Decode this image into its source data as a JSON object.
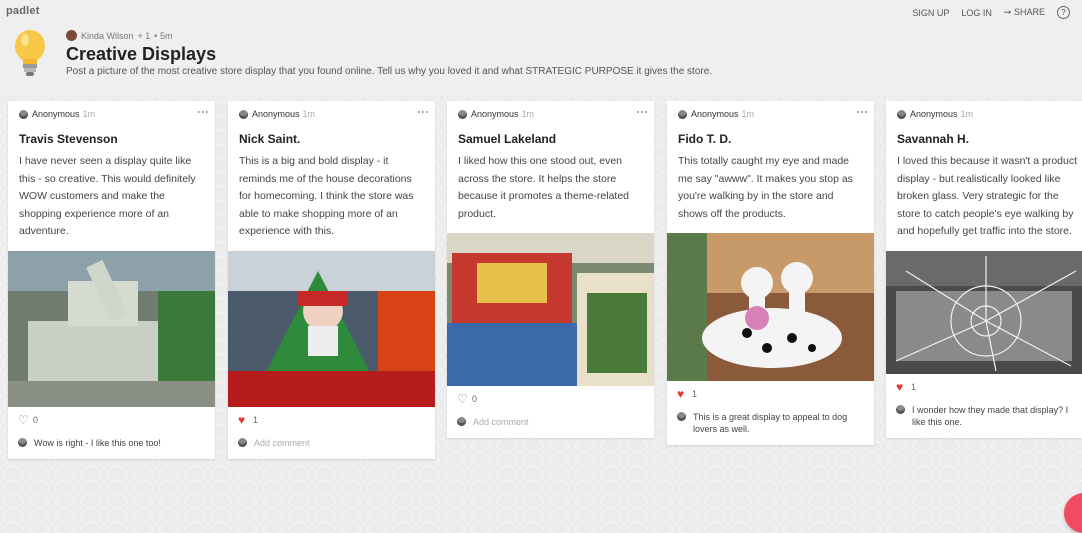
{
  "header": {
    "brand": "padlet",
    "actions": {
      "signup": "SIGN UP",
      "login": "LOG IN",
      "share": "SHARE",
      "share_icon": "➙",
      "help_icon": "?"
    },
    "author": "Kinda Wilson",
    "author_meta": "+ 1",
    "author_time": "• 5m",
    "title": "Creative Displays",
    "description": "Post a picture of the most creative store display that you found online. Tell us why you loved it and what STRATEGIC PURPOSE it gives the store."
  },
  "posts": [
    {
      "author": "Anonymous",
      "time": "1m",
      "title": "Travis Stevenson",
      "body": "I have never seen a display quite like this - so creative. This would definitely WOW customers and make the shopping experience more of an adventure.",
      "image_desc": "tank-display",
      "likes": "0",
      "liked": false,
      "comment": "Wow is right - I like this one too!"
    },
    {
      "author": "Anonymous",
      "time": "1m",
      "title": "Nick Saint.",
      "body": "This is a big and bold display - it reminds me of the house decorations for homecoming. I think the store was able to make shopping more of an experience with this.",
      "image_desc": "santa-display",
      "likes": "1",
      "liked": true,
      "comment": "Add comment"
    },
    {
      "author": "Anonymous",
      "time": "1m",
      "title": "Samuel Lakeland",
      "body": "I liked how this one stood out, even across the store. It helps the store because it promotes a theme-related product.",
      "image_desc": "nfl-display",
      "likes": "0",
      "liked": false,
      "comment": "Add comment"
    },
    {
      "author": "Anonymous",
      "time": "1m",
      "title": "Fido T. D.",
      "body": "This totally caught my eye and made me say \"awww\". It makes you stop as you're walking by in the store and shows off the products.",
      "image_desc": "dalmatian-display",
      "likes": "1",
      "liked": true,
      "comment": "This is a great display to appeal to dog lovers as well."
    },
    {
      "author": "Anonymous",
      "time": "1m",
      "title": "Savannah H.",
      "body": "I loved this because it wasn't a product display - but realistically looked like broken glass. Very strategic for the store to catch people's eye walking by and hopefully get traffic into the store.",
      "image_desc": "broken-glass-display",
      "likes": "1",
      "liked": true,
      "comment": "I wonder how they made that display? I like this one."
    }
  ],
  "icons": {
    "heart_filled": "♥",
    "heart_empty": "♡",
    "menu": "⋮"
  }
}
